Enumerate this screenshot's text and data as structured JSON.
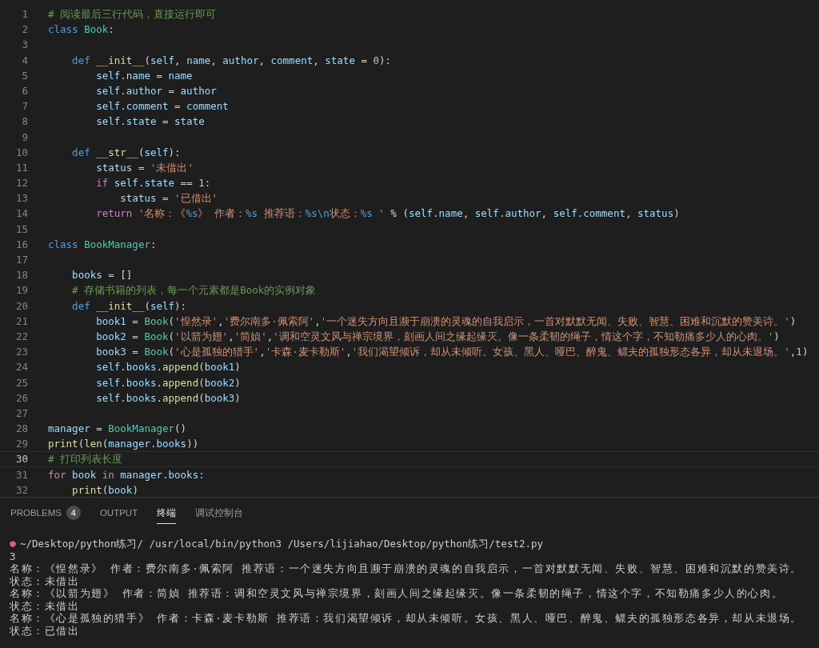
{
  "editor": {
    "lines": [
      {
        "number": "1",
        "current": false,
        "tokens": [
          {
            "kind": "comment",
            "text": "# 阅读最后三行代码，直接运行即可"
          }
        ]
      },
      {
        "number": "2",
        "current": false,
        "tokens": [
          {
            "kind": "keyword",
            "text": "class "
          },
          {
            "kind": "type",
            "text": "Book"
          },
          {
            "kind": "plain",
            "text": ":"
          }
        ]
      },
      {
        "number": "3",
        "current": false
      },
      {
        "number": "4",
        "current": false,
        "tokens": [
          {
            "kind": "keyword",
            "text": "    def "
          },
          {
            "kind": "function",
            "text": "__init__"
          },
          {
            "kind": "plain",
            "text": "("
          },
          {
            "kind": "variable",
            "text": "self"
          },
          {
            "kind": "plain",
            "text": ", "
          },
          {
            "kind": "variable",
            "text": "name"
          },
          {
            "kind": "plain",
            "text": ", "
          },
          {
            "kind": "variable",
            "text": "author"
          },
          {
            "kind": "plain",
            "text": ", "
          },
          {
            "kind": "variable",
            "text": "comment"
          },
          {
            "kind": "plain",
            "text": ", "
          },
          {
            "kind": "variable",
            "text": "state"
          },
          {
            "kind": "plain",
            "text": " = "
          },
          {
            "kind": "number",
            "text": "0"
          },
          {
            "kind": "plain",
            "text": "):"
          }
        ]
      },
      {
        "number": "5",
        "current": false,
        "tokens": [
          {
            "kind": "variable",
            "text": "        self"
          },
          {
            "kind": "plain",
            "text": "."
          },
          {
            "kind": "variable",
            "text": "name"
          },
          {
            "kind": "plain",
            "text": " = "
          },
          {
            "kind": "variable",
            "text": "name"
          }
        ]
      },
      {
        "number": "6",
        "current": false,
        "tokens": [
          {
            "kind": "variable",
            "text": "        self"
          },
          {
            "kind": "plain",
            "text": "."
          },
          {
            "kind": "variable",
            "text": "author"
          },
          {
            "kind": "plain",
            "text": " = "
          },
          {
            "kind": "variable",
            "text": "author"
          }
        ]
      },
      {
        "number": "7",
        "current": false,
        "tokens": [
          {
            "kind": "variable",
            "text": "        self"
          },
          {
            "kind": "plain",
            "text": "."
          },
          {
            "kind": "variable",
            "text": "comment"
          },
          {
            "kind": "plain",
            "text": " = "
          },
          {
            "kind": "variable",
            "text": "comment"
          }
        ]
      },
      {
        "number": "8",
        "current": false,
        "tokens": [
          {
            "kind": "variable",
            "text": "        self"
          },
          {
            "kind": "plain",
            "text": "."
          },
          {
            "kind": "variable",
            "text": "state"
          },
          {
            "kind": "plain",
            "text": " = "
          },
          {
            "kind": "variable",
            "text": "state"
          }
        ]
      },
      {
        "number": "9",
        "current": false
      },
      {
        "number": "10",
        "current": false,
        "tokens": [
          {
            "kind": "keyword",
            "text": "    def "
          },
          {
            "kind": "function",
            "text": "__str__"
          },
          {
            "kind": "plain",
            "text": "("
          },
          {
            "kind": "variable",
            "text": "self"
          },
          {
            "kind": "plain",
            "text": "):"
          }
        ]
      },
      {
        "number": "11",
        "current": false,
        "tokens": [
          {
            "kind": "variable",
            "text": "        status"
          },
          {
            "kind": "plain",
            "text": " = "
          },
          {
            "kind": "string",
            "text": "'未借出'"
          }
        ]
      },
      {
        "number": "12",
        "current": false,
        "tokens": [
          {
            "kind": "control",
            "text": "        if "
          },
          {
            "kind": "variable",
            "text": "self"
          },
          {
            "kind": "plain",
            "text": "."
          },
          {
            "kind": "variable",
            "text": "state"
          },
          {
            "kind": "plain",
            "text": " == "
          },
          {
            "kind": "number",
            "text": "1"
          },
          {
            "kind": "plain",
            "text": ":"
          }
        ]
      },
      {
        "number": "13",
        "current": false,
        "tokens": [
          {
            "kind": "variable",
            "text": "            status"
          },
          {
            "kind": "plain",
            "text": " = "
          },
          {
            "kind": "string",
            "text": "'已借出'"
          }
        ]
      },
      {
        "number": "14",
        "current": false,
        "tokens": [
          {
            "kind": "control",
            "text": "        return "
          },
          {
            "kind": "string",
            "text": "'名称：《"
          },
          {
            "kind": "keyword",
            "text": "%s"
          },
          {
            "kind": "string",
            "text": "》 作者："
          },
          {
            "kind": "keyword",
            "text": "%s"
          },
          {
            "kind": "string",
            "text": " 推荐语："
          },
          {
            "kind": "keyword",
            "text": "%s\\n"
          },
          {
            "kind": "string",
            "text": "状态："
          },
          {
            "kind": "keyword",
            "text": "%s"
          },
          {
            "kind": "string",
            "text": " '"
          },
          {
            "kind": "plain",
            "text": " % ("
          },
          {
            "kind": "variable",
            "text": "self"
          },
          {
            "kind": "plain",
            "text": "."
          },
          {
            "kind": "variable",
            "text": "name"
          },
          {
            "kind": "plain",
            "text": ", "
          },
          {
            "kind": "variable",
            "text": "self"
          },
          {
            "kind": "plain",
            "text": "."
          },
          {
            "kind": "variable",
            "text": "author"
          },
          {
            "kind": "plain",
            "text": ", "
          },
          {
            "kind": "variable",
            "text": "self"
          },
          {
            "kind": "plain",
            "text": "."
          },
          {
            "kind": "variable",
            "text": "comment"
          },
          {
            "kind": "plain",
            "text": ", "
          },
          {
            "kind": "variable",
            "text": "status"
          },
          {
            "kind": "plain",
            "text": ")"
          }
        ]
      },
      {
        "number": "15",
        "current": false
      },
      {
        "number": "16",
        "current": false,
        "tokens": [
          {
            "kind": "keyword",
            "text": "class "
          },
          {
            "kind": "type",
            "text": "BookManager"
          },
          {
            "kind": "plain",
            "text": ":"
          }
        ]
      },
      {
        "number": "17",
        "current": false
      },
      {
        "number": "18",
        "current": false,
        "tokens": [
          {
            "kind": "variable",
            "text": "    books"
          },
          {
            "kind": "plain",
            "text": " = []"
          }
        ]
      },
      {
        "number": "19",
        "current": false,
        "tokens": [
          {
            "kind": "comment",
            "text": "    # 存储书籍的列表，每一个元素都是Book的实例对象"
          }
        ]
      },
      {
        "number": "20",
        "current": false,
        "tokens": [
          {
            "kind": "keyword",
            "text": "    def "
          },
          {
            "kind": "function",
            "text": "__init__"
          },
          {
            "kind": "plain",
            "text": "("
          },
          {
            "kind": "variable",
            "text": "self"
          },
          {
            "kind": "plain",
            "text": "):"
          }
        ]
      },
      {
        "number": "21",
        "current": false,
        "tokens": [
          {
            "kind": "variable",
            "text": "        book1"
          },
          {
            "kind": "plain",
            "text": " = "
          },
          {
            "kind": "type",
            "text": "Book"
          },
          {
            "kind": "plain",
            "text": "("
          },
          {
            "kind": "string",
            "text": "'惶然录'"
          },
          {
            "kind": "plain",
            "text": ","
          },
          {
            "kind": "string",
            "text": "'费尔南多·佩索阿'"
          },
          {
            "kind": "plain",
            "text": ","
          },
          {
            "kind": "string",
            "text": "'一个迷失方向且濒于崩溃的灵魂的自我启示，一首对默默无闻、失败、智慧、困难和沉默的赞美诗。'"
          },
          {
            "kind": "plain",
            "text": ")"
          }
        ]
      },
      {
        "number": "22",
        "current": false,
        "tokens": [
          {
            "kind": "variable",
            "text": "        book2"
          },
          {
            "kind": "plain",
            "text": " = "
          },
          {
            "kind": "type",
            "text": "Book"
          },
          {
            "kind": "plain",
            "text": "("
          },
          {
            "kind": "string",
            "text": "'以箭为翅'"
          },
          {
            "kind": "plain",
            "text": ","
          },
          {
            "kind": "string",
            "text": "'简媜'"
          },
          {
            "kind": "plain",
            "text": ","
          },
          {
            "kind": "string",
            "text": "'调和空灵文风与禅宗境界，刻画人间之缘起缘灭。像一条柔韧的绳子，情这个字，不知勒痛多少人的心肉。'"
          },
          {
            "kind": "plain",
            "text": ")"
          }
        ]
      },
      {
        "number": "23",
        "current": false,
        "tokens": [
          {
            "kind": "variable",
            "text": "        book3"
          },
          {
            "kind": "plain",
            "text": " = "
          },
          {
            "kind": "type",
            "text": "Book"
          },
          {
            "kind": "plain",
            "text": "("
          },
          {
            "kind": "string",
            "text": "'心是孤独的猎手'"
          },
          {
            "kind": "plain",
            "text": ","
          },
          {
            "kind": "string",
            "text": "'卡森·麦卡勒斯'"
          },
          {
            "kind": "plain",
            "text": ","
          },
          {
            "kind": "string",
            "text": "'我们渴望倾诉，却从未倾听。女孩、黑人、哑巴、醉鬼、鳏夫的孤独形态各异，却从未退场。'"
          },
          {
            "kind": "plain",
            "text": ","
          },
          {
            "kind": "number",
            "text": "1"
          },
          {
            "kind": "plain",
            "text": ")"
          }
        ]
      },
      {
        "number": "24",
        "current": false,
        "tokens": [
          {
            "kind": "variable",
            "text": "        self"
          },
          {
            "kind": "plain",
            "text": "."
          },
          {
            "kind": "variable",
            "text": "books"
          },
          {
            "kind": "plain",
            "text": "."
          },
          {
            "kind": "function",
            "text": "append"
          },
          {
            "kind": "plain",
            "text": "("
          },
          {
            "kind": "variable",
            "text": "book1"
          },
          {
            "kind": "plain",
            "text": ")"
          }
        ]
      },
      {
        "number": "25",
        "current": false,
        "tokens": [
          {
            "kind": "variable",
            "text": "        self"
          },
          {
            "kind": "plain",
            "text": "."
          },
          {
            "kind": "variable",
            "text": "books"
          },
          {
            "kind": "plain",
            "text": "."
          },
          {
            "kind": "function",
            "text": "append"
          },
          {
            "kind": "plain",
            "text": "("
          },
          {
            "kind": "variable",
            "text": "book2"
          },
          {
            "kind": "plain",
            "text": ")"
          }
        ]
      },
      {
        "number": "26",
        "current": false,
        "tokens": [
          {
            "kind": "variable",
            "text": "        self"
          },
          {
            "kind": "plain",
            "text": "."
          },
          {
            "kind": "variable",
            "text": "books"
          },
          {
            "kind": "plain",
            "text": "."
          },
          {
            "kind": "function",
            "text": "append"
          },
          {
            "kind": "plain",
            "text": "("
          },
          {
            "kind": "variable",
            "text": "book3"
          },
          {
            "kind": "plain",
            "text": ")"
          }
        ]
      },
      {
        "number": "27",
        "current": false
      },
      {
        "number": "28",
        "current": false,
        "tokens": [
          {
            "kind": "variable",
            "text": "manager"
          },
          {
            "kind": "plain",
            "text": " = "
          },
          {
            "kind": "type",
            "text": "BookManager"
          },
          {
            "kind": "plain",
            "text": "()"
          }
        ]
      },
      {
        "number": "29",
        "current": false,
        "tokens": [
          {
            "kind": "function",
            "text": "print"
          },
          {
            "kind": "plain",
            "text": "("
          },
          {
            "kind": "function",
            "text": "len"
          },
          {
            "kind": "plain",
            "text": "("
          },
          {
            "kind": "variable",
            "text": "manager"
          },
          {
            "kind": "plain",
            "text": "."
          },
          {
            "kind": "variable",
            "text": "books"
          },
          {
            "kind": "plain",
            "text": "))"
          }
        ]
      },
      {
        "number": "30",
        "current": true,
        "tokens": [
          {
            "kind": "comment",
            "text": "# 打印列表长度"
          }
        ]
      },
      {
        "number": "31",
        "current": false,
        "tokens": [
          {
            "kind": "control",
            "text": "for "
          },
          {
            "kind": "variable",
            "text": "book "
          },
          {
            "kind": "control",
            "text": "in "
          },
          {
            "kind": "variable",
            "text": "manager"
          },
          {
            "kind": "plain",
            "text": "."
          },
          {
            "kind": "variable",
            "text": "books"
          },
          {
            "kind": "plain",
            "text": ":"
          }
        ]
      },
      {
        "number": "32",
        "current": false,
        "tokens": [
          {
            "kind": "function",
            "text": "    print"
          },
          {
            "kind": "plain",
            "text": "("
          },
          {
            "kind": "variable",
            "text": "book"
          },
          {
            "kind": "plain",
            "text": ")"
          }
        ]
      }
    ]
  },
  "panel": {
    "tabs": [
      {
        "label": "PROBLEMS",
        "badge": "4",
        "selected": false
      },
      {
        "label": "OUTPUT",
        "selected": false
      },
      {
        "label": "终端",
        "selected": true
      },
      {
        "label": "调试控制台",
        "selected": false
      }
    ],
    "terminal": {
      "command": "~/Desktop/python练习/ /usr/local/bin/python3 /Users/lijiahao/Desktop/python练习/test2.py",
      "output": [
        "3",
        "名称：《惶然录》 作者：费尔南多·佩索阿 推荐语：一个迷失方向且濒于崩溃的灵魂的自我启示，一首对默默无闻、失败、智慧、困难和沉默的赞美诗。",
        "状态：未借出",
        "名称：《以箭为翅》 作者：简媜 推荐语：调和空灵文风与禅宗境界，刻画人间之缘起缘灭。像一条柔韧的绳子，情这个字，不知勒痛多少人的心肉。",
        "状态：未借出",
        "名称：《心是孤独的猎手》 作者：卡森·麦卡勒斯 推荐语：我们渴望倾诉，却从未倾听。女孩、黑人、哑巴、醉鬼、鳏夫的孤独形态各异，却从未退场。",
        "状态：已借出"
      ]
    }
  }
}
